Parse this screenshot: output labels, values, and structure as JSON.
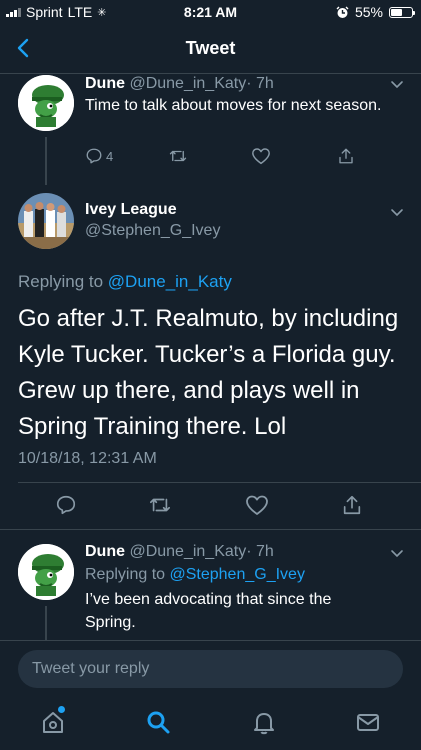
{
  "status_bar": {
    "carrier": "Sprint",
    "network": "LTE",
    "time": "8:21 AM",
    "battery_percent": "55%",
    "battery_level": 0.55
  },
  "nav": {
    "title": "Tweet",
    "back_icon": "chevron-left-icon"
  },
  "tweets": {
    "parent": {
      "name": "Dune",
      "handle": "@Dune_in_Katy",
      "time": "· 7h",
      "text": "Time to talk about moves for next season.",
      "reply_count": "4"
    },
    "main": {
      "name": "Ivey League",
      "handle": "@Stephen_G_Ivey",
      "replying_prefix": "Replying to",
      "replying_to": "@Dune_in_Katy",
      "text": "Go after J.T. Realmuto, by including Kyle Tucker. Tucker’s a Florida guy. Grew up there, and plays well in Spring Training there. Lol",
      "timestamp": "10/18/18, 12:31 AM"
    },
    "reply": {
      "name": "Dune",
      "handle": "@Dune_in_Katy",
      "time": "· 7h",
      "replying_prefix": "Replying to",
      "replying_to": "@Stephen_G_Ivey",
      "text": "I’ve been advocating that since the Spring."
    }
  },
  "compose": {
    "placeholder": "Tweet your reply"
  },
  "tab_bar": {
    "items": [
      "home-icon",
      "search-icon",
      "notifications-icon",
      "messages-icon"
    ],
    "active": "search-icon"
  },
  "colors": {
    "background": "#15202b",
    "accent": "#1da1f2",
    "secondary_text": "#8899a6",
    "divider": "#38444d"
  }
}
